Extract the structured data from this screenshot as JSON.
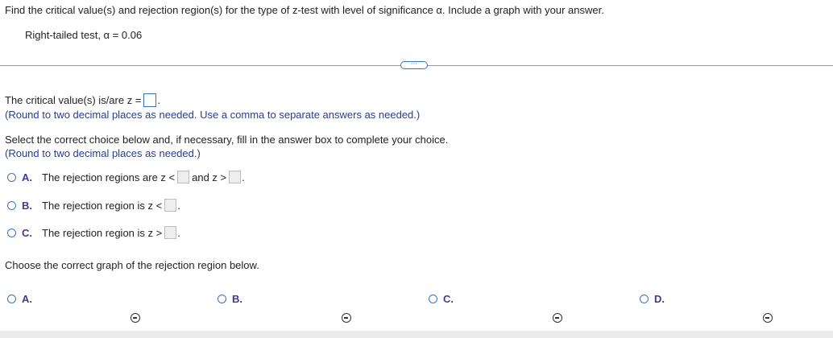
{
  "question": {
    "prompt": "Find the critical value(s) and rejection region(s) for the type of z-test with level of significance α. Include a graph with your answer.",
    "test": "Right-tailed test, α = 0.06"
  },
  "more_button": "···",
  "critical": {
    "label": "The critical value(s) is/are z =",
    "period": ".",
    "hint": "(Round to two decimal places as needed. Use a comma to separate answers as needed.)"
  },
  "select": {
    "instruction": "Select the correct choice below and, if necessary, fill in the answer box to complete your choice.",
    "hint": "(Round to two decimal places as needed.)"
  },
  "choices": [
    {
      "letter": "A.",
      "text": "The rejection regions are z <",
      "mid": "and z >",
      "end": "."
    },
    {
      "letter": "B.",
      "text": "The rejection region is z <",
      "end": "."
    },
    {
      "letter": "C.",
      "text": "The rejection region is z >",
      "end": "."
    }
  ],
  "graph": {
    "prompt": "Choose the correct graph of the rejection region below.",
    "options": [
      "A.",
      "B.",
      "C.",
      "D."
    ]
  }
}
